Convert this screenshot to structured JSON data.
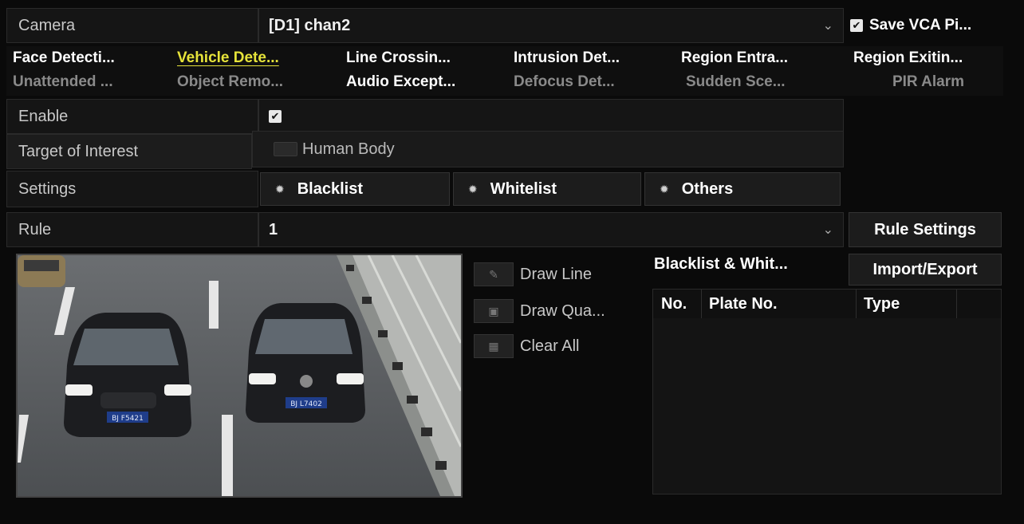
{
  "camera": {
    "label": "Camera",
    "value": "[D1] chan2",
    "save_vca_label": "Save VCA Pi..."
  },
  "tabs_row1": [
    "Face Detecti...",
    "Vehicle Dete...",
    "Line Crossin...",
    "Intrusion Det...",
    "Region Entra...",
    "Region Exitin..."
  ],
  "tabs_row2": [
    "Unattended ...",
    "Object Remo...",
    "Audio Except...",
    "Defocus Det...",
    "Sudden Sce...",
    "PIR Alarm"
  ],
  "enable": {
    "label": "Enable",
    "checked": true
  },
  "target": {
    "label": "Target of Interest",
    "option": "Human Body",
    "checked": false
  },
  "settings": {
    "label": "Settings",
    "buttons": [
      "Blacklist",
      "Whitelist",
      "Others"
    ]
  },
  "rule": {
    "label": "Rule",
    "value": "1",
    "button": "Rule Settings"
  },
  "tools": {
    "draw_line": "Draw Line",
    "draw_quad": "Draw Qua...",
    "clear_all": "Clear All"
  },
  "list": {
    "title": "Blacklist & Whit...",
    "import_export": "Import/Export",
    "columns": [
      "No.",
      "Plate No.",
      "Type"
    ]
  },
  "preview": {
    "plate_left": "BJ F5421",
    "plate_right": "BJ L7402"
  }
}
